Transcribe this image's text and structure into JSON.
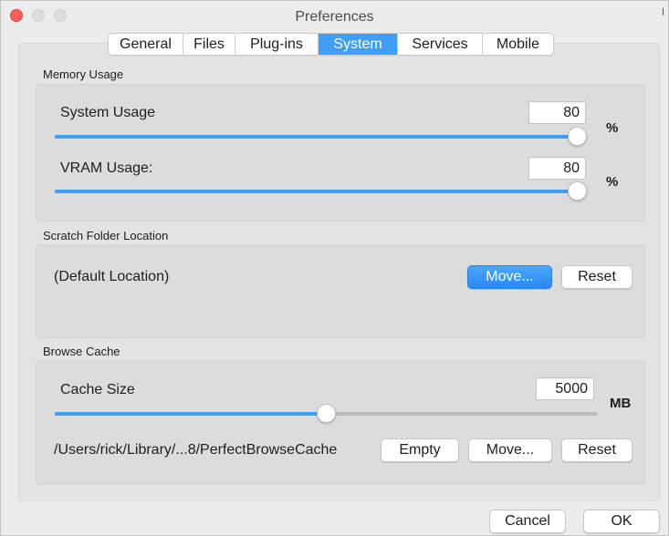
{
  "window": {
    "title": "Preferences"
  },
  "tabs": [
    {
      "label": "General"
    },
    {
      "label": "Files"
    },
    {
      "label": "Plug-ins"
    },
    {
      "label": "System",
      "active": true
    },
    {
      "label": "Services"
    },
    {
      "label": "Mobile"
    }
  ],
  "memory": {
    "section_label": "Memory Usage",
    "system": {
      "label": "System Usage",
      "value": "80",
      "unit": "%",
      "slider_percent": 100
    },
    "vram": {
      "label": "VRAM Usage:",
      "value": "80",
      "unit": "%",
      "slider_percent": 100
    }
  },
  "scratch": {
    "section_label": "Scratch Folder Location",
    "location": "(Default Location)",
    "move_label": "Move...",
    "reset_label": "Reset"
  },
  "cache": {
    "section_label": "Browse Cache",
    "size_label": "Cache Size",
    "size_value": "5000",
    "unit": "MB",
    "slider_percent": 50,
    "path": "/Users/rick/Library/...8/PerfectBrowseCache",
    "empty_label": "Empty",
    "move_label": "Move...",
    "reset_label": "Reset"
  },
  "footer": {
    "cancel_label": "Cancel",
    "ok_label": "OK"
  },
  "colors": {
    "accent": "#3f9ff8",
    "close": "#fc605c"
  }
}
